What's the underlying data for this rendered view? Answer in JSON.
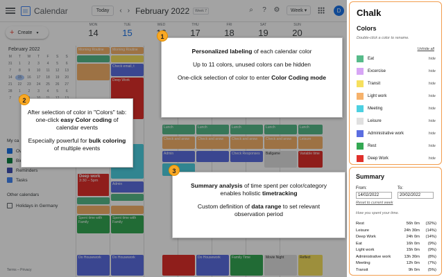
{
  "app": {
    "title": "Calendar",
    "today_label": "Today",
    "prev_icon": "chevron-left-icon",
    "next_icon": "chevron-right-icon",
    "month_label": "February 2022",
    "week_chip": "Week 7",
    "view_label": "Week",
    "avatar_letter": "D"
  },
  "sidebar": {
    "create_label": "Create",
    "mini_month": "February 2022",
    "mini_days": [
      "M",
      "T",
      "W",
      "T",
      "F",
      "S",
      "S",
      "31",
      "1",
      "2",
      "3",
      "4",
      "5",
      "6",
      "7",
      "8",
      "9",
      "10",
      "11",
      "12",
      "13",
      "14",
      "15",
      "16",
      "17",
      "18",
      "19",
      "20",
      "21",
      "22",
      "23",
      "24",
      "25",
      "26",
      "27",
      "28",
      "1",
      "2",
      "3",
      "4",
      "5",
      "6",
      "7",
      "8",
      "9",
      "10",
      "11",
      "12",
      "13"
    ],
    "my_calendars_label": "My ca",
    "calendar_items": [
      {
        "label": "Ove",
        "color": "#1a73e8"
      },
      {
        "label": "Birt",
        "color": "#0b8043"
      },
      {
        "label": "Reminders",
        "color": "#3f51b5"
      },
      {
        "label": "Tasks",
        "color": "#4285f4"
      }
    ],
    "other_calendars_label": "Other calendars",
    "other_items": [
      {
        "label": "Holidays in Germany"
      }
    ],
    "footer": "Terms – Privacy"
  },
  "days": [
    {
      "name": "MON",
      "num": "14"
    },
    {
      "name": "TUE",
      "num": "15"
    },
    {
      "name": "WED",
      "num": "16"
    },
    {
      "name": "THU",
      "num": "17"
    },
    {
      "name": "FRI",
      "num": "18"
    },
    {
      "name": "SAT",
      "num": "19"
    },
    {
      "name": "SUN",
      "num": "20"
    }
  ],
  "events": {
    "deep_work_sel": {
      "title": "Deep work",
      "time": "3:30 – 5pm"
    },
    "morning_routine": "Morning Routine",
    "check_email": "Check email, t",
    "weekly_planning": "Weekly Planning",
    "deep_work": "Deep Work",
    "lunch": "Lunch",
    "lunch_time": "12 – 1pm",
    "admin": "Admin",
    "leisure": "Leisure",
    "spent_time": "Spent time with Family",
    "do_housework": "Do Housework",
    "check_and_answ": "Check and answ",
    "check_responses": "Check Responses",
    "ballgame": "Ballgame",
    "variable_time": "Variable time",
    "movie_night": "Movie Night",
    "reflect": "Reflect",
    "family_time": "Family Time"
  },
  "callouts": {
    "c1": {
      "badge": "1",
      "line1_b": "Personalized labeling",
      "line1_r": " of each calendar color",
      "line2": "Up to 11 colors, unused colors can be hidden",
      "line3_r": "One-click selection of color to enter ",
      "line3_b": "Color Coding mode"
    },
    "c2": {
      "badge": "2",
      "line1_r": "After selection of color in \"Colors\" tab: one-click ",
      "line1_b": "easy Color coding",
      "line1_r2": " of calendar events",
      "line2_r": "Especially powerful for ",
      "line2_b": "bulk coloring",
      "line2_r2": " of multiple events"
    },
    "c3": {
      "badge": "3",
      "line1_b": "Summary analysis",
      "line1_r": " of time spent per color/category enables holistic ",
      "line1_b2": "timetracking",
      "line2_r": "Custom definition of ",
      "line2_b": "data range",
      "line2_r2": " to set relevant observation period"
    }
  },
  "chalk": {
    "title": "Chalk",
    "colors_heading": "Colors",
    "hint": "Double-click a color to rename.",
    "unhide_all": "Unhide all",
    "hide_label": "hide",
    "colors": [
      {
        "name": "Eat",
        "color": "#57bb8a"
      },
      {
        "name": "Excercise",
        "color": "#d7a6f5"
      },
      {
        "name": "Transit",
        "color": "#f6e05e"
      },
      {
        "name": "Light work",
        "color": "#f6b26b"
      },
      {
        "name": "Meeting",
        "color": "#4dd0e1"
      },
      {
        "name": "Leisure",
        "color": "#e0e0e0"
      },
      {
        "name": "Administrative work",
        "color": "#5b6ee1"
      },
      {
        "name": "Rest",
        "color": "#34a853"
      },
      {
        "name": "Deep Work",
        "color": "#e0302b"
      }
    ]
  },
  "summary": {
    "title": "Summary",
    "from_label": "From:",
    "to_label": "To:",
    "from_value": "14/02/2022",
    "to_value": "20/02/2022",
    "reset_label": "Reset to current week",
    "note": "How you spent your time.",
    "rows": [
      {
        "name": "Rest",
        "hours": "56h 0m",
        "pct": "(32%)"
      },
      {
        "name": "Leisure",
        "hours": "24h 30m",
        "pct": "(14%)"
      },
      {
        "name": "Deep Work",
        "hours": "24h 0m",
        "pct": "(14%)"
      },
      {
        "name": "Eat",
        "hours": "16h 0m",
        "pct": "(9%)"
      },
      {
        "name": "Light work",
        "hours": "15h 0m",
        "pct": "(9%)"
      },
      {
        "name": "Administrative work",
        "hours": "13h 30m",
        "pct": "(8%)"
      },
      {
        "name": "Meeting",
        "hours": "12h 0m",
        "pct": "(7%)"
      },
      {
        "name": "Transit",
        "hours": "9h 0m",
        "pct": "(5%)"
      }
    ]
  }
}
